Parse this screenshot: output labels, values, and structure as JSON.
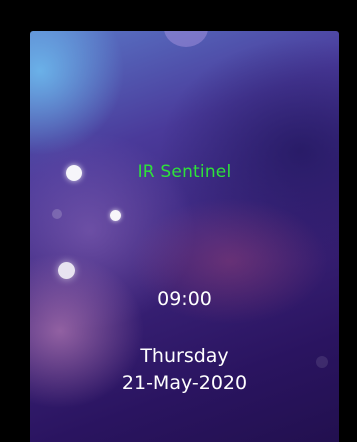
{
  "screen": {
    "title": "IR Sentinel",
    "time": "09:00",
    "day": "Thursday",
    "date": "21-May-2020"
  },
  "colors": {
    "title": "#2ee23a",
    "text": "#ffffff",
    "frame": "#000000"
  }
}
